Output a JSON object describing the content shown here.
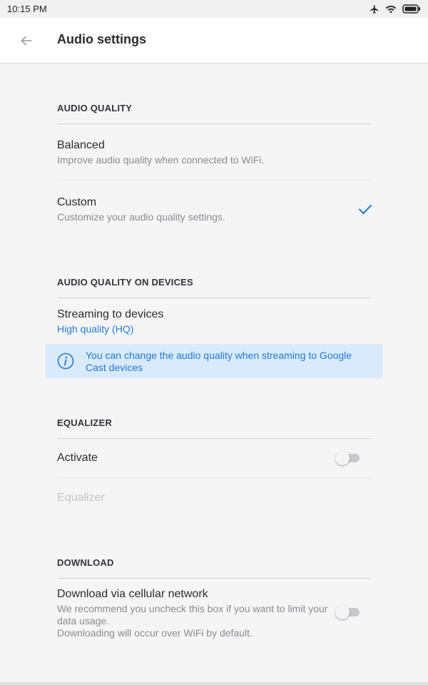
{
  "status_bar": {
    "time": "10:15 PM",
    "icons": [
      "airplane-icon",
      "wifi-icon",
      "battery-icon"
    ]
  },
  "app_bar": {
    "back_icon": "arrow-left-icon",
    "title": "Audio settings"
  },
  "audio_quality": {
    "header": "AUDIO QUALITY",
    "options": [
      {
        "title": "Balanced",
        "subtitle": "Improve audio quality when connected to WiFi.",
        "selected": false
      },
      {
        "title": "Custom",
        "subtitle": "Customize your audio quality settings.",
        "selected": true
      }
    ]
  },
  "devices": {
    "header": "AUDIO QUALITY ON DEVICES",
    "streaming_title": "Streaming to devices",
    "streaming_value": "High quality (HQ)",
    "info_text": "You can change the audio quality when streaming to Google Cast devices"
  },
  "equalizer": {
    "header": "EQUALIZER",
    "activate_label": "Activate",
    "activate_on": false,
    "equalizer_label": "Equalizer"
  },
  "download": {
    "header": "DOWNLOAD",
    "cellular_title": "Download via cellular network",
    "cellular_sub_1": "We recommend you uncheck this box if you want to limit your data usage.",
    "cellular_sub_2": "Downloading will occur over WiFi by default.",
    "cellular_on": false
  },
  "colors": {
    "accent": "#1f7bd4",
    "info_bg": "#d8eafb",
    "background": "#f5f5f6"
  }
}
